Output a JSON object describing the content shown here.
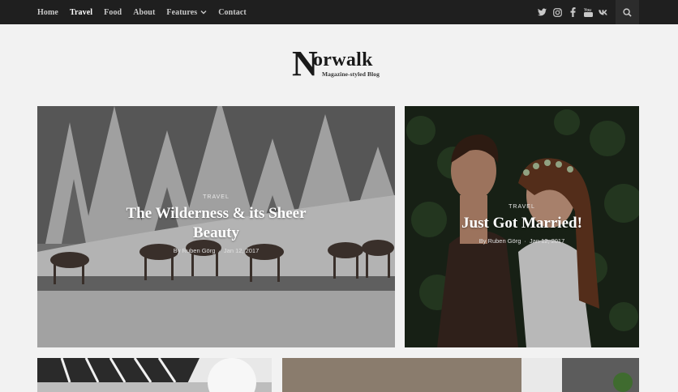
{
  "nav": {
    "items": [
      {
        "label": "Home",
        "active": false
      },
      {
        "label": "Travel",
        "active": true
      },
      {
        "label": "Food",
        "active": false
      },
      {
        "label": "About",
        "active": false
      },
      {
        "label": "Features",
        "active": false,
        "has_dropdown": true
      },
      {
        "label": "Contact",
        "active": false
      }
    ],
    "social_icons": [
      "twitter-icon",
      "instagram-icon",
      "facebook-icon",
      "youtube-icon",
      "vk-icon"
    ],
    "search_icon": "search-icon"
  },
  "logo": {
    "initial": "N",
    "rest": "orwalk",
    "tagline": "Magazine-styled Blog"
  },
  "featured": [
    {
      "category": "Travel",
      "title_line1": "The Wilderness & its Sheer",
      "title_line2": "Beauty",
      "author": "By Ruben Görg",
      "separator": "·",
      "date": "Jan 12, 2017"
    },
    {
      "category": "Travel",
      "title_line1": "Just Got Married!",
      "author": "By Ruben Görg",
      "separator": "·",
      "date": "Jan 12, 2017"
    }
  ],
  "colors": {
    "topbar": "#1f1f1f",
    "page_bg": "#f2f2f2",
    "nav_text": "#c9c9c9",
    "nav_active": "#ffffff"
  }
}
